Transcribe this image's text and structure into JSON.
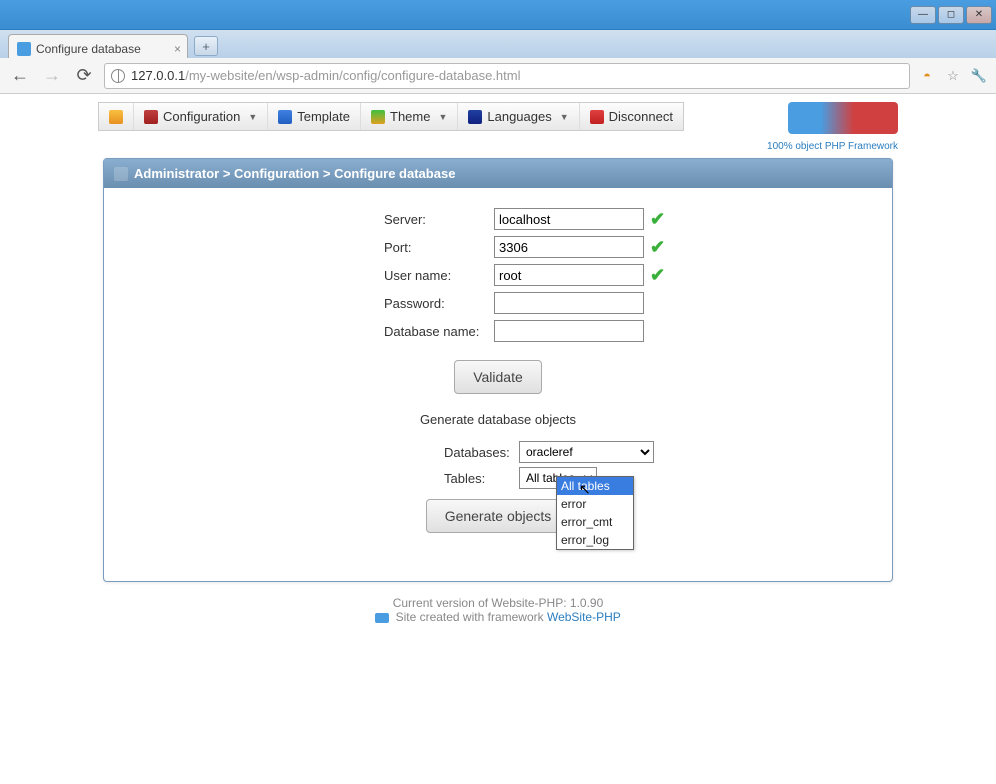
{
  "window": {
    "tab_title": "Configure database",
    "url_host": "127.0.0.1",
    "url_path": "/my-website/en/wsp-admin/config/configure-database.html"
  },
  "menu": {
    "home": "",
    "configuration": "Configuration",
    "template": "Template",
    "theme": "Theme",
    "languages": "Languages",
    "disconnect": "Disconnect"
  },
  "logo": {
    "tagline": "100% object PHP Framework"
  },
  "breadcrumb": "Administrator > Configuration > Configure database",
  "form": {
    "server_label": "Server:",
    "server_value": "localhost",
    "port_label": "Port:",
    "port_value": "3306",
    "user_label": "User name:",
    "user_value": "root",
    "password_label": "Password:",
    "password_value": "",
    "dbname_label": "Database name:",
    "dbname_value": "",
    "validate_btn": "Validate"
  },
  "generate": {
    "heading": "Generate database objects",
    "databases_label": "Databases:",
    "databases_value": "oracleref",
    "tables_label": "Tables:",
    "tables_value": "All tables",
    "options": [
      "All tables",
      "error",
      "error_cmt",
      "error_log"
    ],
    "generate_btn": "Generate objects"
  },
  "footer": {
    "line1": "Current version of Website-PHP: 1.0.90",
    "line2_prefix": "Site created with framework ",
    "line2_link": "WebSite-PHP"
  }
}
